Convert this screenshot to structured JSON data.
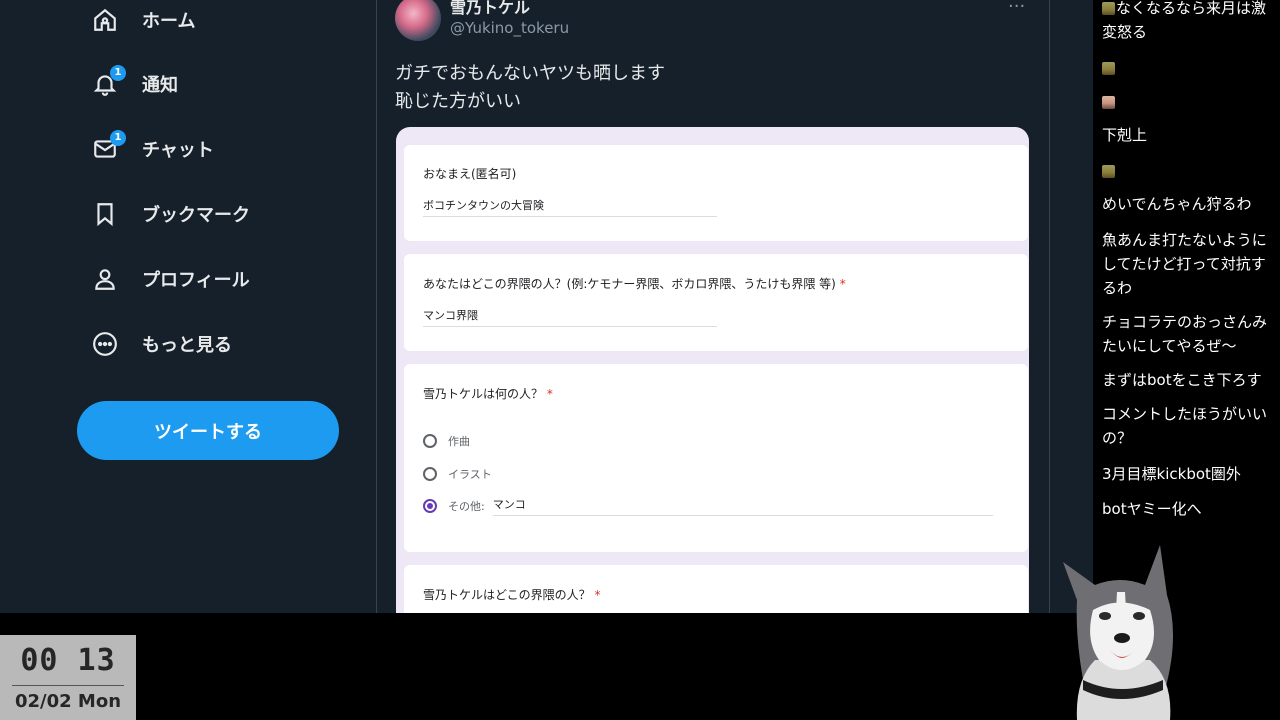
{
  "sidebar": {
    "items": [
      {
        "label": "ホーム",
        "icon": "home-icon",
        "badge": ""
      },
      {
        "label": "通知",
        "icon": "bell-icon",
        "badge": "1"
      },
      {
        "label": "チャット",
        "icon": "mail-icon",
        "badge": "1"
      },
      {
        "label": "ブックマーク",
        "icon": "bookmark-icon",
        "badge": ""
      },
      {
        "label": "プロフィール",
        "icon": "person-icon",
        "badge": ""
      },
      {
        "label": "もっと見る",
        "icon": "more-circle-icon",
        "badge": ""
      }
    ],
    "tweet_button": "ツイートする"
  },
  "tweet": {
    "author_name": "雪乃トケル",
    "handle": "@Yukino_tokeru",
    "lines": [
      "ガチでおもんないヤツも晒します",
      "恥じた方がいい"
    ],
    "more_icon": "ellipsis-icon"
  },
  "form": {
    "q1": {
      "title": "おなまえ(匿名可)",
      "answer": "ボコチンタウンの大冒険"
    },
    "q2": {
      "title": "あなたはどこの界隈の人？(例:ケモナー界隈、ボカロ界隈、うたけも界隈 等)",
      "required": "*",
      "answer": "マンコ界隈"
    },
    "q3": {
      "title": "雪乃トケルは何の人？",
      "required": "*",
      "options": [
        "作曲",
        "イラスト",
        "その他:"
      ],
      "other_value": "マンコ",
      "selected_index": 2
    },
    "q4": {
      "title": "雪乃トケルはどこの界隈の人？",
      "required": "*"
    },
    "accent": "#673ab7"
  },
  "comments": [
    {
      "emoji": "chick",
      "text": "なくなるなら来月は激変怒る"
    },
    {
      "emoji": "chick",
      "text": ""
    },
    {
      "emoji": "person",
      "text": ""
    },
    {
      "emoji": "",
      "text": "下剋上"
    },
    {
      "emoji": "chick",
      "text": ""
    },
    {
      "emoji": "",
      "text": "めいでんちゃん狩るわ"
    },
    {
      "emoji": "",
      "text": "魚あんま打たないようにしてたけど打って対抗するわ"
    },
    {
      "emoji": "",
      "text": "チョコラテのおっさんみたいにしてやるぜ～"
    },
    {
      "emoji": "",
      "text": "まずはbotをこき下ろす"
    },
    {
      "emoji": "",
      "text": "コメントしたほうがいいの？"
    },
    {
      "emoji": "",
      "text": "3月目標kickbot圏外"
    },
    {
      "emoji": "",
      "text": "botヤミー化へ"
    }
  ],
  "clock": {
    "time": "00 13",
    "date": "02/02 Mon"
  },
  "colors": {
    "bg": "#15202b",
    "accent_blue": "#1d9bf0",
    "form_bg": "#ede7f6"
  }
}
